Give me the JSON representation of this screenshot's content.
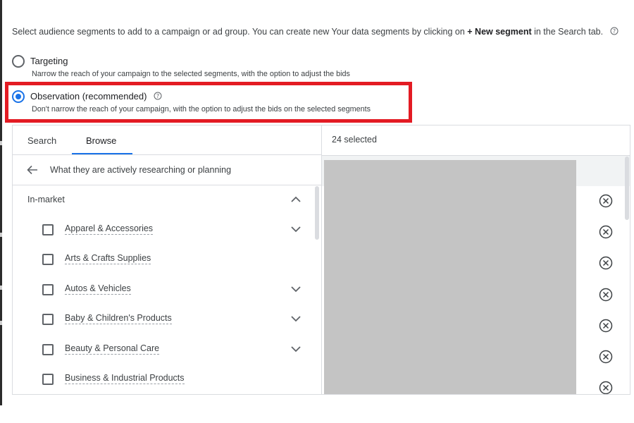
{
  "intro": {
    "text_before": "Select audience segments to add to a campaign or ad group. You can create new Your data segments by clicking on ",
    "text_bold": "+ New segment",
    "text_after": " in the Search tab.",
    "help_icon": "help-circle-icon"
  },
  "options": [
    {
      "label": "Targeting",
      "description": "Narrow the reach of your campaign to the selected segments, with the option to adjust the bids",
      "checked": false
    },
    {
      "label": "Observation (recommended)",
      "description": "Don't narrow the reach of your campaign, with the option to adjust the bids on the selected segments",
      "checked": true
    }
  ],
  "tabs": [
    {
      "label": "Search",
      "active": false
    },
    {
      "label": "Browse",
      "active": true
    }
  ],
  "browse": {
    "path": "What they are actively researching or planning",
    "section": "In-market",
    "categories": [
      {
        "label": "Apparel & Accessories",
        "expandable": true
      },
      {
        "label": "Arts & Crafts Supplies",
        "expandable": false
      },
      {
        "label": "Autos & Vehicles",
        "expandable": true
      },
      {
        "label": "Baby & Children's Products",
        "expandable": true
      },
      {
        "label": "Beauty & Personal Care",
        "expandable": true
      },
      {
        "label": "Business & Industrial Products",
        "expandable": false
      }
    ]
  },
  "selected": {
    "count_label": "24 selected",
    "remove_icon": "remove-circle-icon"
  },
  "colors": {
    "accent": "#1a73e8",
    "highlight": "#e31b23",
    "redaction": "#c4c4c4"
  }
}
